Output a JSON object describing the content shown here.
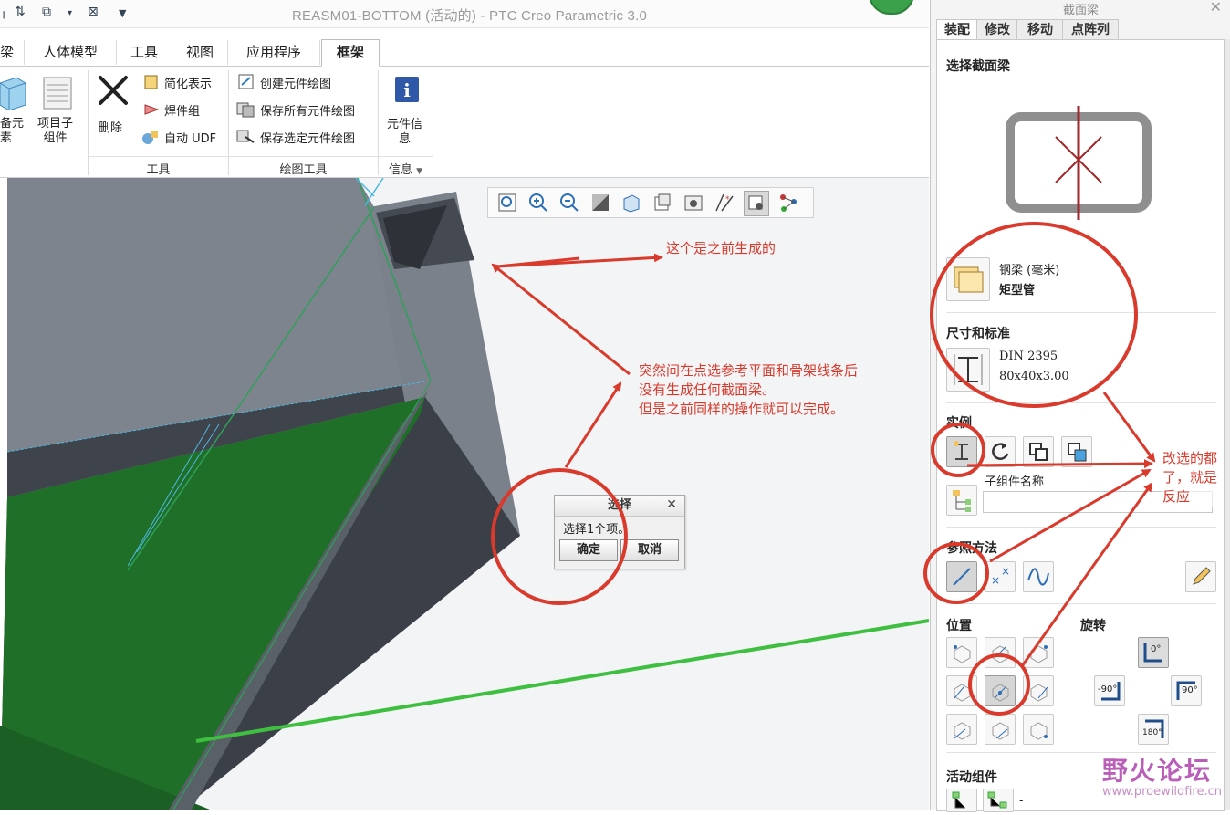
{
  "window": {
    "title": "REASM01-BOTTOM (活动的) - PTC Creo Parametric 3.0"
  },
  "tabs": [
    {
      "label": "梁"
    },
    {
      "label": "人体模型"
    },
    {
      "label": "工具"
    },
    {
      "label": "视图"
    },
    {
      "label": "应用程序"
    },
    {
      "label": "框架"
    }
  ],
  "ribbon": {
    "btn_prepare": "备元\n素",
    "btn_project": "项目子\n组件",
    "btn_delete": "删除",
    "tools": {
      "simplified": "简化表示",
      "weld_group": "焊件组",
      "auto_udf": "自动 UDF"
    },
    "drawing": {
      "create_drawing": "创建元件绘图",
      "save_all": "保存所有元件绘图",
      "save_selected": "保存选定元件绘图"
    },
    "btn_info": "元件信\n息",
    "groups": {
      "tools": "工具",
      "drawing_tools": "绘图工具",
      "info": "信息"
    }
  },
  "select_dialog": {
    "title": "选择",
    "message": "选择1个项。",
    "ok": "确定",
    "cancel": "取消"
  },
  "panel": {
    "title": "截面梁",
    "tabs": [
      "装配",
      "修改",
      "移动",
      "点阵列"
    ],
    "select_beam_label": "选择截面梁",
    "beam_family": "钢梁 (毫米)",
    "beam_type": "矩型管",
    "size_std_label": "尺寸和标准",
    "standard": "DIN 2395",
    "size": "80x40x3.00",
    "instance_label": "实例",
    "subasm_name_label": "子组件名称",
    "ref_method_label": "参照方法",
    "position_label": "位置",
    "rotation_label": "旋转",
    "rot_0": "0°",
    "rot_m90": "-90°",
    "rot_90": "90°",
    "rot_180": "180°",
    "active_comp_label": "活动组件",
    "active_comp_value": "-"
  },
  "annotations": {
    "note1": "这个是之前生成的",
    "note2_line1": "突然间在点选参考平面和骨架线条后",
    "note2_line2": "没有生成任何截面梁。",
    "note2_line3": "但是之前同样的操作就可以完成。",
    "note3_line1": "改选的都",
    "note3_line2": "了，就是",
    "note3_line3": "反应"
  },
  "watermark": {
    "text": "野火论坛",
    "url": "www.proewildfire.cn"
  },
  "colors": {
    "annotation_red": "#d93a2c",
    "beam_green": "#1f7a2a",
    "beam_gray": "#7d848e",
    "beam_dark": "#3c4048",
    "guide_line_green": "#3fbf3f"
  }
}
